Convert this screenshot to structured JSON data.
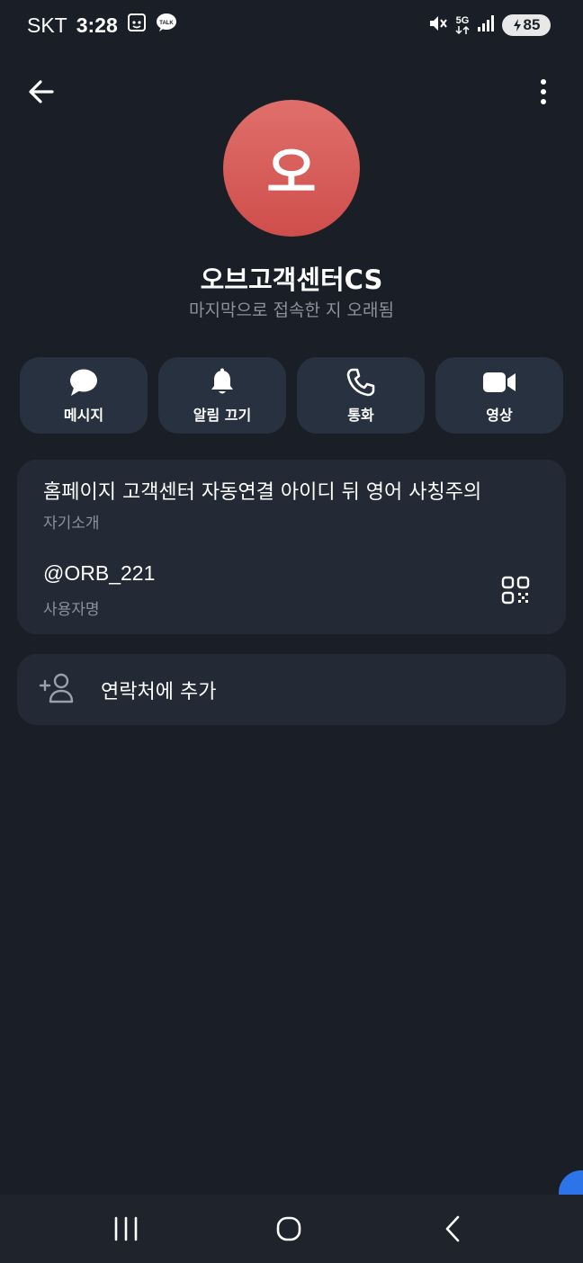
{
  "status_bar": {
    "carrier": "SKT",
    "time": "3:28",
    "network": "5G",
    "battery": "85"
  },
  "profile": {
    "avatar_initial": "오",
    "avatar_color": "#d9605d",
    "name": "오브고객센터CS",
    "last_seen": "마지막으로 접속한 지 오래됨"
  },
  "actions": [
    {
      "label": "메시지",
      "icon": "chat-bubble-icon"
    },
    {
      "label": "알림 끄기",
      "icon": "bell-icon"
    },
    {
      "label": "통화",
      "icon": "phone-icon"
    },
    {
      "label": "영상",
      "icon": "video-camera-icon"
    }
  ],
  "info": {
    "bio": "홈페이지 고객센터 자동연결 아이디 뒤 영어 사칭주의",
    "bio_label": "자기소개",
    "username": "@ORB_221",
    "username_label": "사용자명"
  },
  "add_contact": {
    "label": "연락처에 추가",
    "icon": "add-person-icon"
  },
  "colors": {
    "background": "#1a1f27",
    "card": "#232a35",
    "action_button": "#283140",
    "secondary_text": "#8b929b",
    "accent": "#2d74e8"
  }
}
